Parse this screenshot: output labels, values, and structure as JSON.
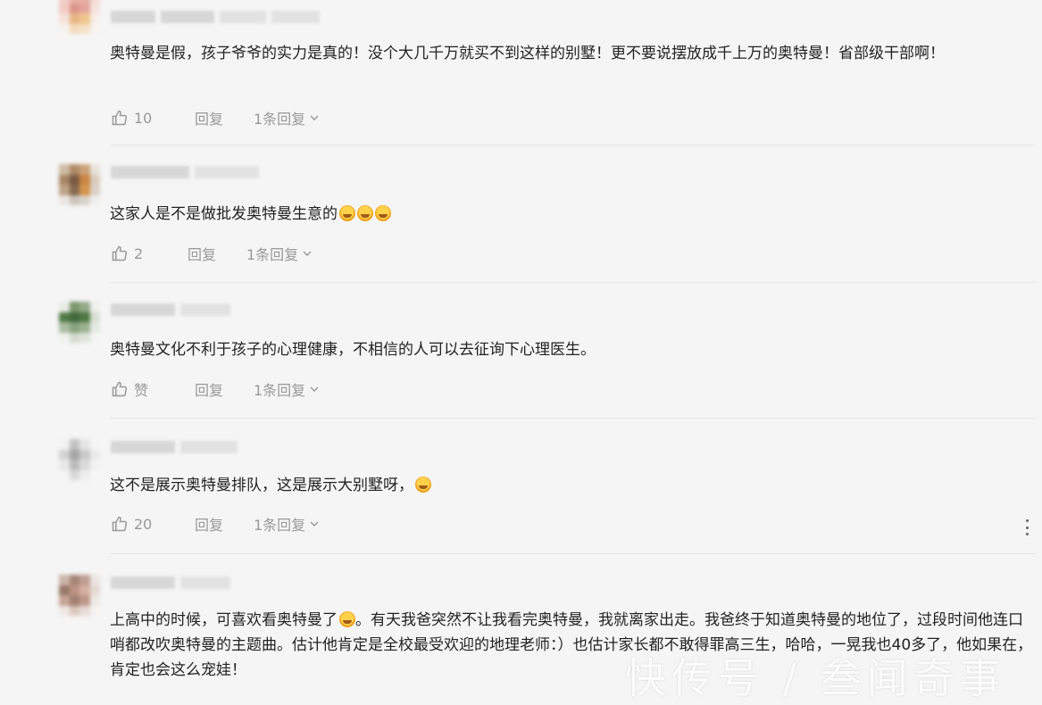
{
  "comments": [
    {
      "text": "奥特曼是假，孩子爷爷的实力是真的！没个大几千万就买不到这样的别墅！更不要说摆放成千上万的奥特曼！省部级干部啊！",
      "likes": "10",
      "reply_label": "回复",
      "replies_label": "1条回复"
    },
    {
      "text": "这家人是不是做批发奥特曼生意的",
      "likes": "2",
      "reply_label": "回复",
      "replies_label": "1条回复"
    },
    {
      "text": "奥特曼文化不利于孩子的心理健康，不相信的人可以去征询下心理医生。",
      "likes": "赞",
      "reply_label": "回复",
      "replies_label": "1条回复"
    },
    {
      "text": "这不是展示奥特曼排队，这是展示大别墅呀，",
      "likes": "20",
      "reply_label": "回复",
      "replies_label": "1条回复"
    },
    {
      "text_part1": "上高中的时候，可喜欢看奥特曼了",
      "text_part2": "。有天我爸突然不让我看完奥特曼，我就离家出走。我爸终于知道奥特曼的地位了，过段时间他连口哨都改吹奥特曼的主题曲。估计他肯定是全校最受欢迎的地理老师：）也估计家长都不敢得罪高三生，哈哈，一晃我也40多了，他如果在，肯定也会这么宠娃！"
    }
  ],
  "watermark": "快传号 / 叁闻奇事",
  "icons": {
    "like": "thumbs-up-icon",
    "chevron": "chevron-down-icon",
    "emoji": "laughing-emoji-icon",
    "more": "more-vertical-icon"
  }
}
